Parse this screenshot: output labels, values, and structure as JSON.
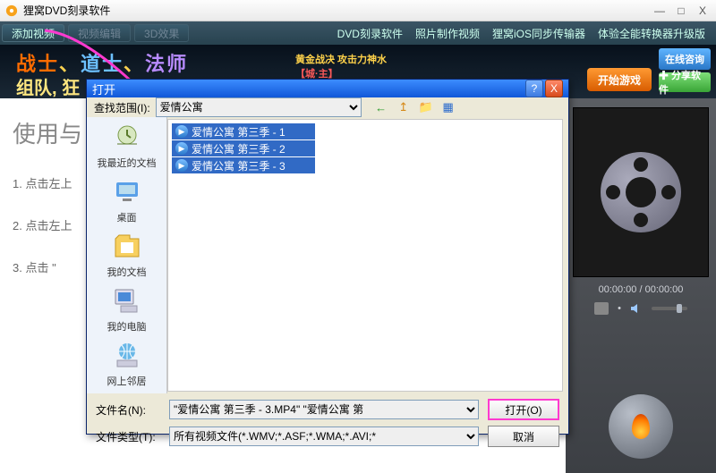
{
  "app": {
    "title": "狸窝DVD刻录软件"
  },
  "window_buttons": {
    "min": "—",
    "max": "□",
    "close": "X"
  },
  "toolbar": {
    "add_video": "添加视频",
    "video_edit": "视频编辑",
    "effect_3d": "3D效果",
    "links": [
      "DVD刻录软件",
      "照片制作视频",
      "狸窝iOS同步传输器",
      "体验全能转换器升级版"
    ]
  },
  "banner": {
    "w1": "战士",
    "w2": "道士",
    "w3": "法师",
    "sep": "、",
    "line2": "组队, 狂",
    "deco_top": "黄金战决  攻击力神水",
    "deco_mid": "【城·主】",
    "online": "在线咨询",
    "start": "开始游戏",
    "share": "✚ 分享软件"
  },
  "guide": {
    "heading": "使用与",
    "steps": [
      "1. 点击左上",
      "2. 点击左上",
      "3. 点击 \""
    ]
  },
  "preview": {
    "time": "00:00:00 / 00:00:00",
    "vol_dot": "•"
  },
  "dialog": {
    "title": "打开",
    "lookin_label": "查找范围(I):",
    "lookin_value": "爱情公寓",
    "nav": {
      "back": "←",
      "up": "↥",
      "newfolder": "📁",
      "views": "▦"
    },
    "places": [
      "我最近的文档",
      "桌面",
      "我的文档",
      "我的电脑",
      "网上邻居"
    ],
    "files": [
      "爱情公寓 第三季 - 1",
      "爱情公寓 第三季 - 2",
      "爱情公寓 第三季 - 3"
    ],
    "filename_label": "文件名(N):",
    "filename_value": "\"爱情公寓 第三季 - 3.MP4\" \"爱情公寓 第",
    "filetype_label": "文件类型(T):",
    "filetype_value": "所有视频文件(*.WMV;*.ASF;*.WMA;*.AVI;*",
    "open_btn": "打开(O)",
    "cancel_btn": "取消"
  },
  "colors": {
    "highlight": "#ff3ad0",
    "selection": "#316ac5"
  }
}
